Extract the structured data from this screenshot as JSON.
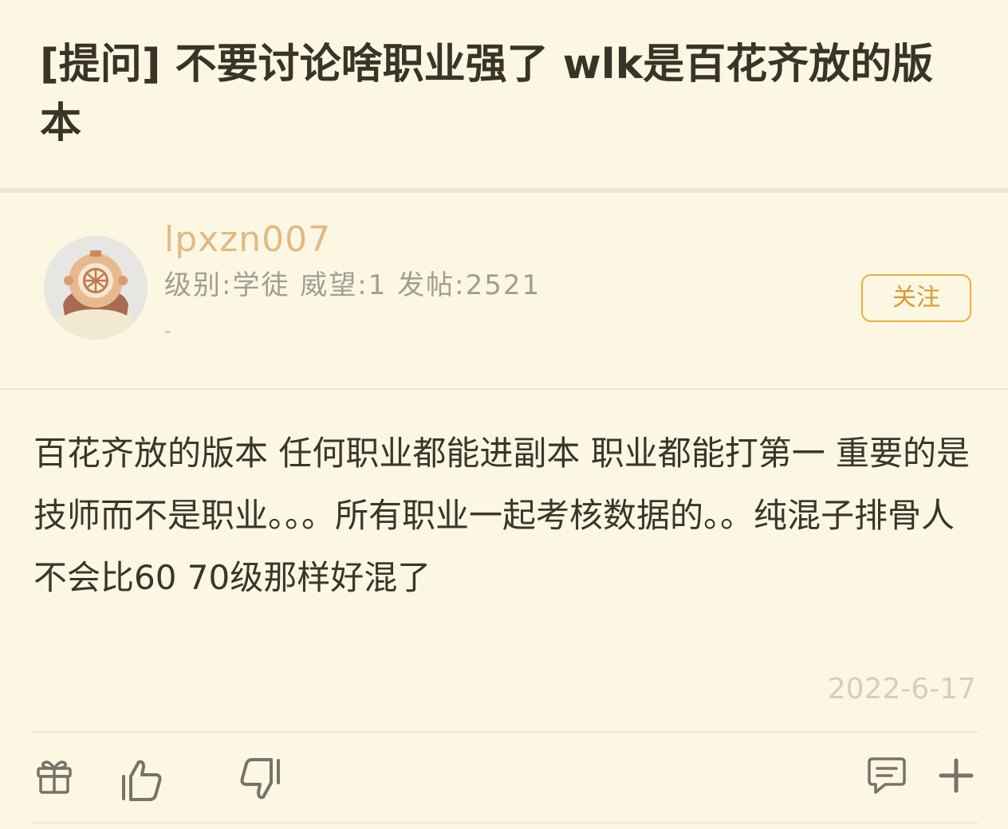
{
  "post": {
    "title": "[提问] 不要讨论啥职业强了 wlk是百花齐放的版本",
    "body": "百花齐放的版本 任何职业都能进副本 职业都能打第一 重要的是技师而不是职业。。。所有职业一起考核数据的。。纯混子排骨人不会比60 70级那样好混了",
    "date": "2022-6-17"
  },
  "author": {
    "username": "lpxzn007",
    "stats": "级别:学徒 威望:1 发帖:2521",
    "extra": "-",
    "follow_label": "关注"
  },
  "toolbar": {
    "icons": [
      "gift-icon",
      "thumbs-up-icon",
      "thumbs-down-icon",
      "comment-icon",
      "plus-icon"
    ]
  },
  "colors": {
    "background": "#fcf7e2",
    "username": "#e2b985",
    "accent": "#ecad3a",
    "text": "#3b352b",
    "muted": "#a29e92"
  }
}
